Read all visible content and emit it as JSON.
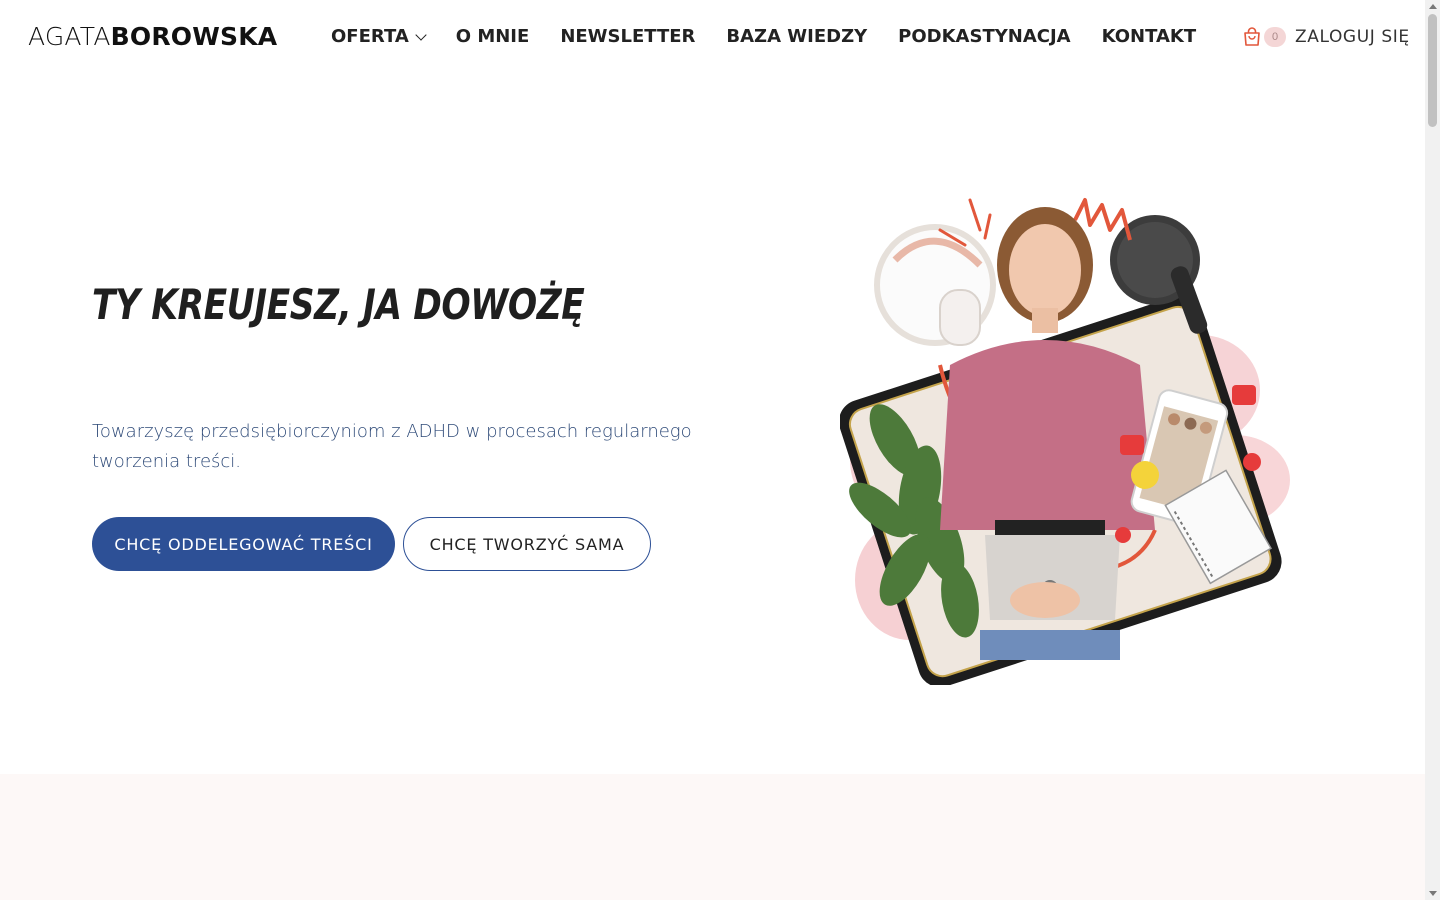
{
  "header": {
    "logo_light": "AGATA",
    "logo_bold": "BOROWSKA",
    "nav": [
      {
        "label": "OFERTA"
      },
      {
        "label": "O MNIE"
      },
      {
        "label": "NEWSLETTER"
      },
      {
        "label": "BAZA WIEDZY"
      },
      {
        "label": "PODKASTYNACJA"
      },
      {
        "label": "KONTAKT"
      }
    ],
    "cart_count": "0",
    "login_label": "ZALOGUJ SIĘ"
  },
  "hero": {
    "title": "TY KREUJESZ, JA DOWOŻĘ",
    "text": "Towarzyszę przedsiębiorczyniom z ADHD w procesach regularnego tworzenia treści.",
    "primary_button": "CHCĘ ODDELEGOWAĆ TREŚCI",
    "secondary_button": "CHCĘ TWORZYĆ SAMA"
  },
  "colors": {
    "accent": "#2d5096",
    "text_blue": "#2e4a78",
    "pink_bg": "#fdf8f7",
    "cart_accent": "#e2573b"
  },
  "icons": {
    "cart": "shopping-bag-icon",
    "dropdown": "chevron-down-icon"
  }
}
